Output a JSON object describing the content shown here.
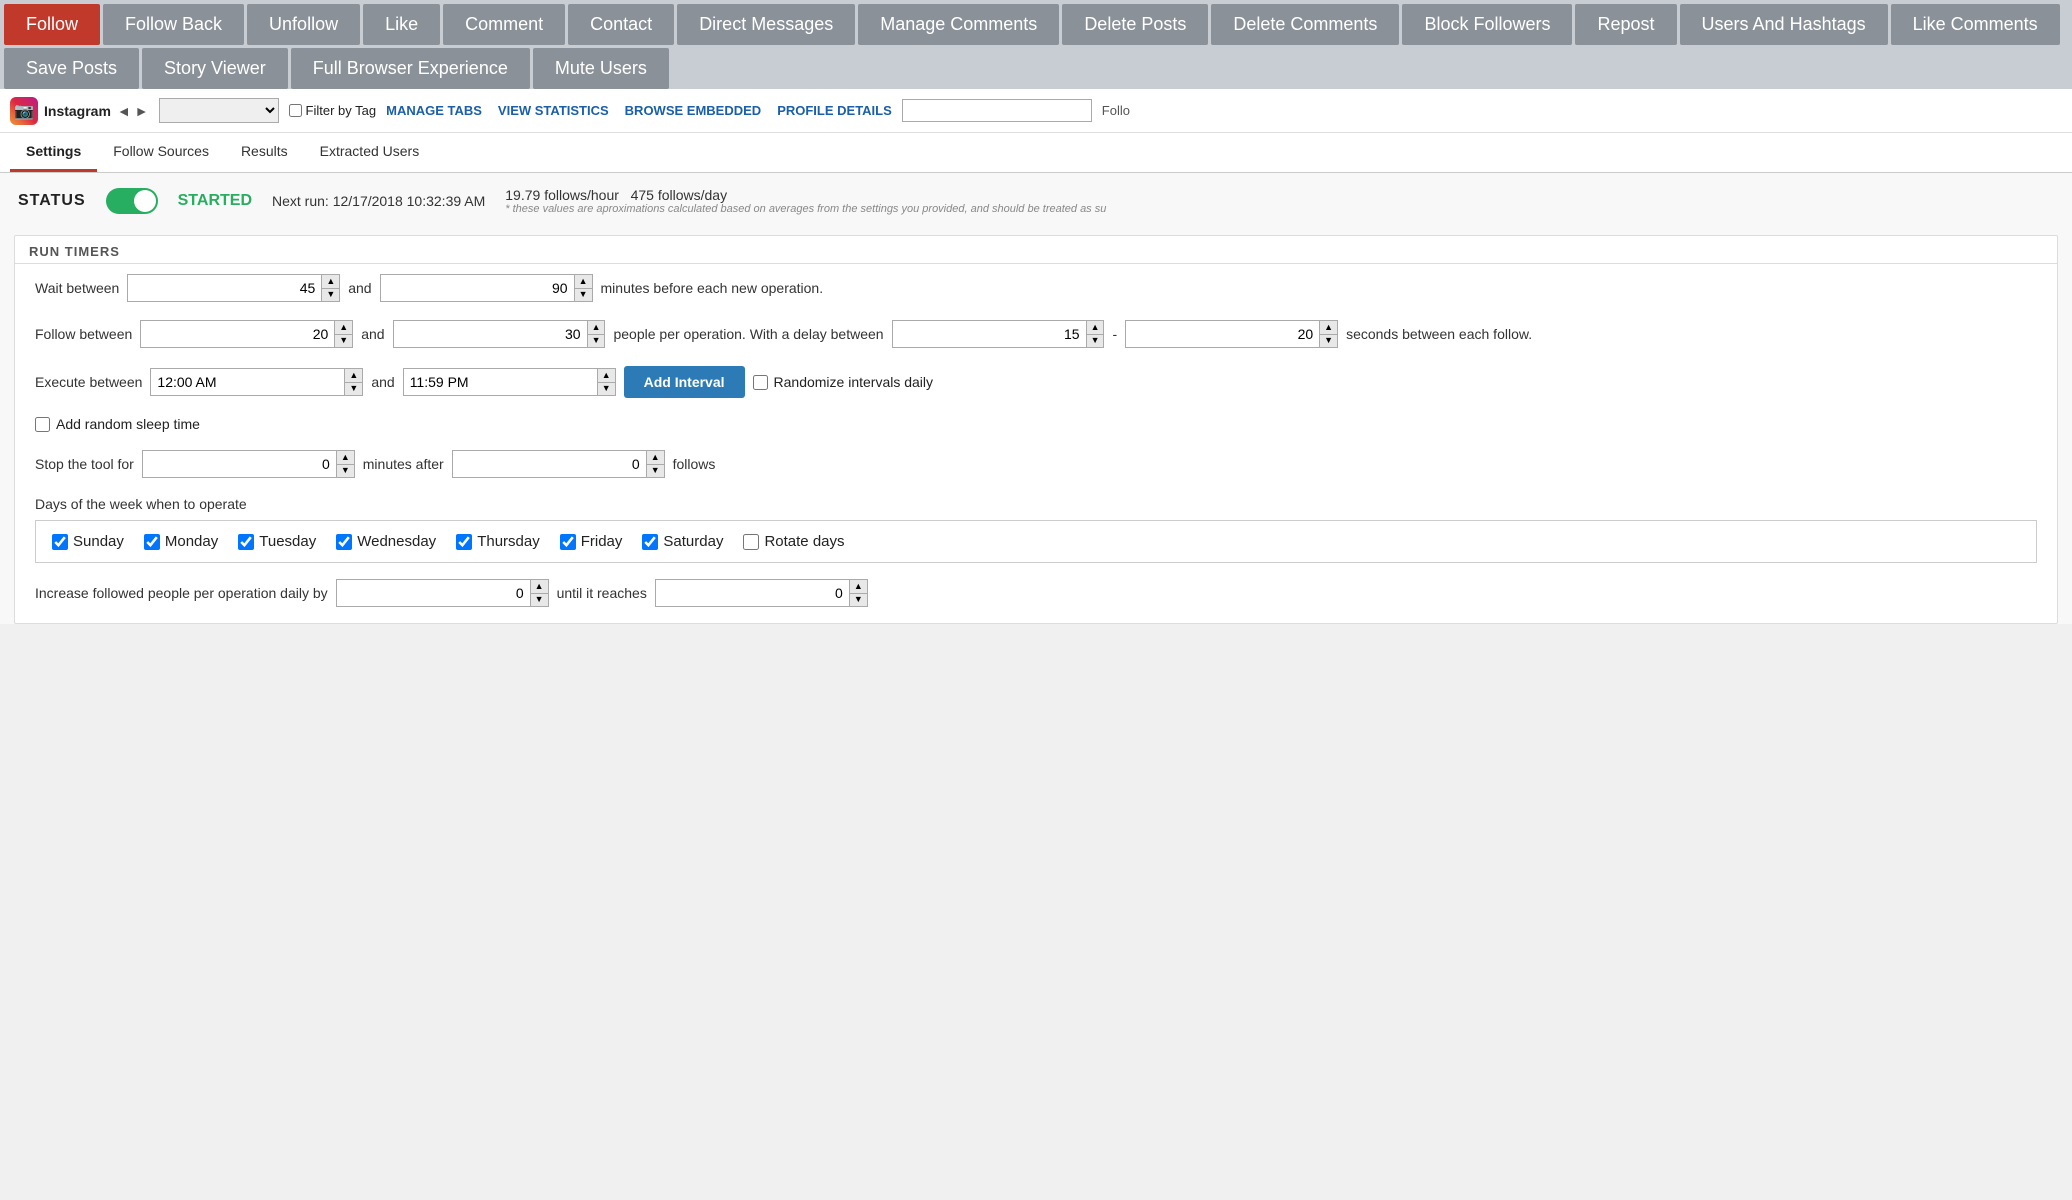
{
  "topNav": {
    "buttons": [
      {
        "id": "follow",
        "label": "Follow",
        "active": true
      },
      {
        "id": "follow-back",
        "label": "Follow Back"
      },
      {
        "id": "unfollow",
        "label": "Unfollow"
      },
      {
        "id": "like",
        "label": "Like"
      },
      {
        "id": "comment",
        "label": "Comment"
      },
      {
        "id": "contact",
        "label": "Contact"
      },
      {
        "id": "direct-messages",
        "label": "Direct Messages"
      },
      {
        "id": "manage-comments",
        "label": "Manage Comments"
      },
      {
        "id": "delete-posts",
        "label": "Delete Posts"
      },
      {
        "id": "delete-comments",
        "label": "Delete Comments"
      },
      {
        "id": "block-followers",
        "label": "Block Followers"
      },
      {
        "id": "repost",
        "label": "Repost"
      },
      {
        "id": "users-hashtags",
        "label": "Users And Hashtags"
      },
      {
        "id": "like-comments",
        "label": "Like Comments"
      },
      {
        "id": "save-posts",
        "label": "Save Posts"
      },
      {
        "id": "story-viewer",
        "label": "Story Viewer"
      },
      {
        "id": "full-browser",
        "label": "Full Browser Experience"
      },
      {
        "id": "mute-users",
        "label": "Mute Users"
      }
    ]
  },
  "toolbar": {
    "platform": "Instagram",
    "filterByTag": "Filter by Tag",
    "manageTabs": "MANAGE TABS",
    "viewStatistics": "VIEW STATISTICS",
    "browseEmbedded": "BROWSE EMBEDDED",
    "profileDetails": "PROFILE DETAILS",
    "followLabel": "Follo"
  },
  "tabs": [
    {
      "id": "settings",
      "label": "Settings",
      "active": true
    },
    {
      "id": "follow-sources",
      "label": "Follow Sources"
    },
    {
      "id": "results",
      "label": "Results"
    },
    {
      "id": "extracted-users",
      "label": "Extracted Users"
    }
  ],
  "status": {
    "label": "STATUS",
    "started": true,
    "startedLabel": "STARTED",
    "nextRun": "Next run: 12/17/2018 10:32:39 AM",
    "followsPerHour": "19.79 follows/hour",
    "followsPerDay": "475 follows/day",
    "note": "* these values are aproximations calculated based on averages from the settings you provided, and should be treated as su"
  },
  "runTimers": {
    "sectionTitle": "RUN TIMERS",
    "waitBetweenLabel": "Wait between",
    "waitMin": 45,
    "waitMax": 90,
    "waitSuffix": "minutes before each new operation.",
    "followBetweenLabel": "Follow between",
    "followMin": 20,
    "followMax": 30,
    "followMid": "and",
    "followSuffix": "people per operation. With a delay between",
    "delayMin": 15,
    "delayMax": 20,
    "delaySuffix": "seconds between each follow.",
    "executeBetweenLabel": "Execute between",
    "executeStart": "12:00 AM",
    "executeEnd": "11:59 PM",
    "addIntervalLabel": "Add Interval",
    "randomizeLabel": "Randomize intervals daily",
    "addRandomSleepLabel": "Add random sleep time",
    "stopToolLabel": "Stop the tool for",
    "stopMinutes": 0,
    "stopMinutesSuffix": "minutes after",
    "stopFollows": 0,
    "stopFollowsSuffix": "follows",
    "daysLabel": "Days of the week when to operate",
    "days": [
      {
        "id": "sunday",
        "label": "Sunday",
        "checked": true
      },
      {
        "id": "monday",
        "label": "Monday",
        "checked": true
      },
      {
        "id": "tuesday",
        "label": "Tuesday",
        "checked": true
      },
      {
        "id": "wednesday",
        "label": "Wednesday",
        "checked": true
      },
      {
        "id": "thursday",
        "label": "Thursday",
        "checked": true
      },
      {
        "id": "friday",
        "label": "Friday",
        "checked": true
      },
      {
        "id": "saturday",
        "label": "Saturday",
        "checked": true
      },
      {
        "id": "rotate-days",
        "label": "Rotate days",
        "checked": false
      }
    ],
    "increaseLabel": "Increase followed people per operation daily by",
    "increaseValue": 0,
    "untilLabel": "until it reaches",
    "untilValue": 0
  }
}
